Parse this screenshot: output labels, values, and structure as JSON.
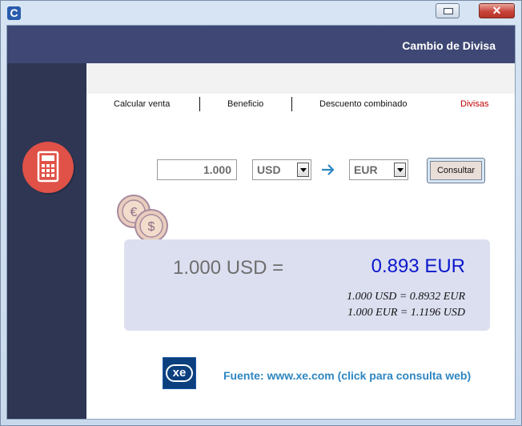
{
  "window": {
    "icon_letter": "C",
    "restore_icon": "restore-icon",
    "close_glyph": "✕"
  },
  "header": {
    "title": "Cambio de Divisa"
  },
  "tabs": [
    {
      "label": "Calcular venta"
    },
    {
      "label": "Beneficio"
    },
    {
      "label": "Descuento combinado"
    },
    {
      "label": "Divisas",
      "active": true
    }
  ],
  "form": {
    "amount": "1.000",
    "from_currency": "USD",
    "to_currency": "EUR",
    "consult_label": "Consultar"
  },
  "result": {
    "left": "1.000 USD =",
    "right": "0.893 EUR",
    "rate_forward": "1.000 USD = 0.8932 EUR",
    "rate_reverse": "1.000 EUR = 1.1196 USD"
  },
  "footer": {
    "logo_text": "xe",
    "source_text": "Fuente: www.xe.com (click para consulta web)"
  },
  "colors": {
    "header_bg": "#3f4874",
    "sidebar_bg": "#2e3653",
    "active_tab": "#c00000",
    "result_value": "#0b18cc",
    "link": "#2e86c1",
    "calc_badge": "#e05147"
  }
}
